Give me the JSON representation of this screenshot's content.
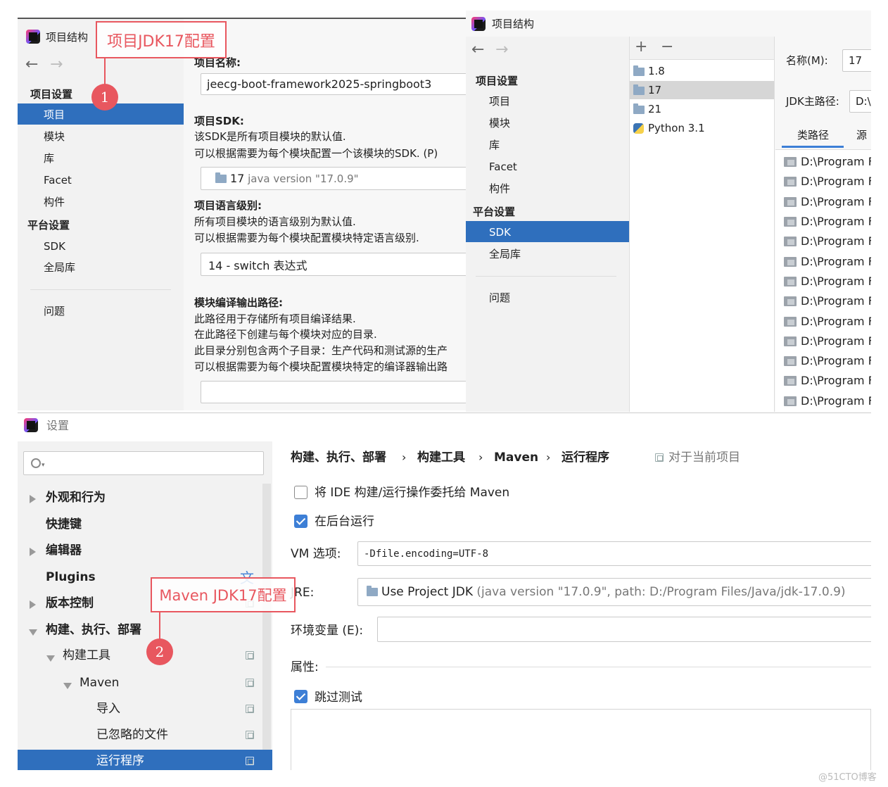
{
  "win1": {
    "title": "项目结构",
    "nav": {
      "section_project": "项目设置",
      "items_project": [
        "项目",
        "模块",
        "库",
        "Facet",
        "构件"
      ],
      "section_platform": "平台设置",
      "items_platform": [
        "SDK",
        "全局库"
      ],
      "problems": "问题"
    },
    "main": {
      "name_label": "项目名称:",
      "name_value": "jeecg-boot-framework2025-springboot3",
      "sdk_label": "项目SDK:",
      "sdk_desc1": "该SDK是所有项目模块的默认值.",
      "sdk_desc2": "可以根据需要为每个模块配置一个该模块的SDK. (P)",
      "sdk_value_num": "17",
      "sdk_value_ver": "java version \"17.0.9\"",
      "lang_label": "项目语言级别:",
      "lang_desc1": "所有项目模块的语言级别为默认值.",
      "lang_desc2": "可以根据需要为每个模块配置模块特定语言级别.",
      "lang_value": "14 - switch 表达式",
      "out_label": "模块编译输出路径:",
      "out_desc1": "此路径用于存储所有项目编译结果.",
      "out_desc2": "在此路径下创建与每个模块对应的目录.",
      "out_desc3": "此目录分别包含两个子目录：生产代码和测试源的生产",
      "out_desc4": "可以根据需要为每个模块配置模块特定的编译器输出路"
    },
    "annotation": "项目JDK17配置",
    "badge": "1"
  },
  "win2": {
    "title": "项目结构",
    "nav": {
      "section_project": "项目设置",
      "items_project": [
        "项目",
        "模块",
        "库",
        "Facet",
        "构件"
      ],
      "section_platform": "平台设置",
      "items_platform": [
        "SDK",
        "全局库"
      ],
      "problems": "问题"
    },
    "sdk_list": [
      "1.8",
      "17",
      "21",
      "Python 3.1"
    ],
    "name_label": "名称(M):",
    "name_value": "17",
    "home_label": "JDK主路径:",
    "home_value": "D:\\",
    "tabs": [
      "类路径",
      "源"
    ],
    "classpath_item": "D:\\Program F",
    "classpath_count": 13
  },
  "win3": {
    "title": "设置",
    "search_placeholder": "",
    "tree": [
      "外观和行为",
      "快捷键",
      "编辑器",
      "Plugins",
      "版本控制",
      "构建、执行、部署",
      "构建工具",
      "Maven",
      "导入",
      "已忽略的文件",
      "运行程序"
    ],
    "breadcrumb": [
      "构建、执行、部署",
      "构建工具",
      "Maven",
      "运行程序"
    ],
    "scope": "对于当前项目",
    "delegate_label": "将 IDE 构建/运行操作委托给 Maven",
    "background_label": "在后台运行",
    "vm_label": "VM 选项:",
    "vm_value": "-Dfile.encoding=UTF-8",
    "jre_label": "JRE:",
    "jre_value_main": "Use Project JDK",
    "jre_value_detail": "(java version \"17.0.9\", path: D:/Program Files/Java/jdk-17.0.9)",
    "env_label": "环境变量 (E):",
    "props_label": "属性:",
    "skip_tests_label": "跳过测试",
    "annotation": "Maven JDK17配置",
    "badge": "2",
    "delegate_checked": false,
    "background_checked": true,
    "skip_tests_checked": true
  },
  "watermark": "@51CTO博客",
  "colors": {
    "accent": "#2f6fbd",
    "annotation": "#e8575f",
    "panel": "#f2f2f2"
  }
}
